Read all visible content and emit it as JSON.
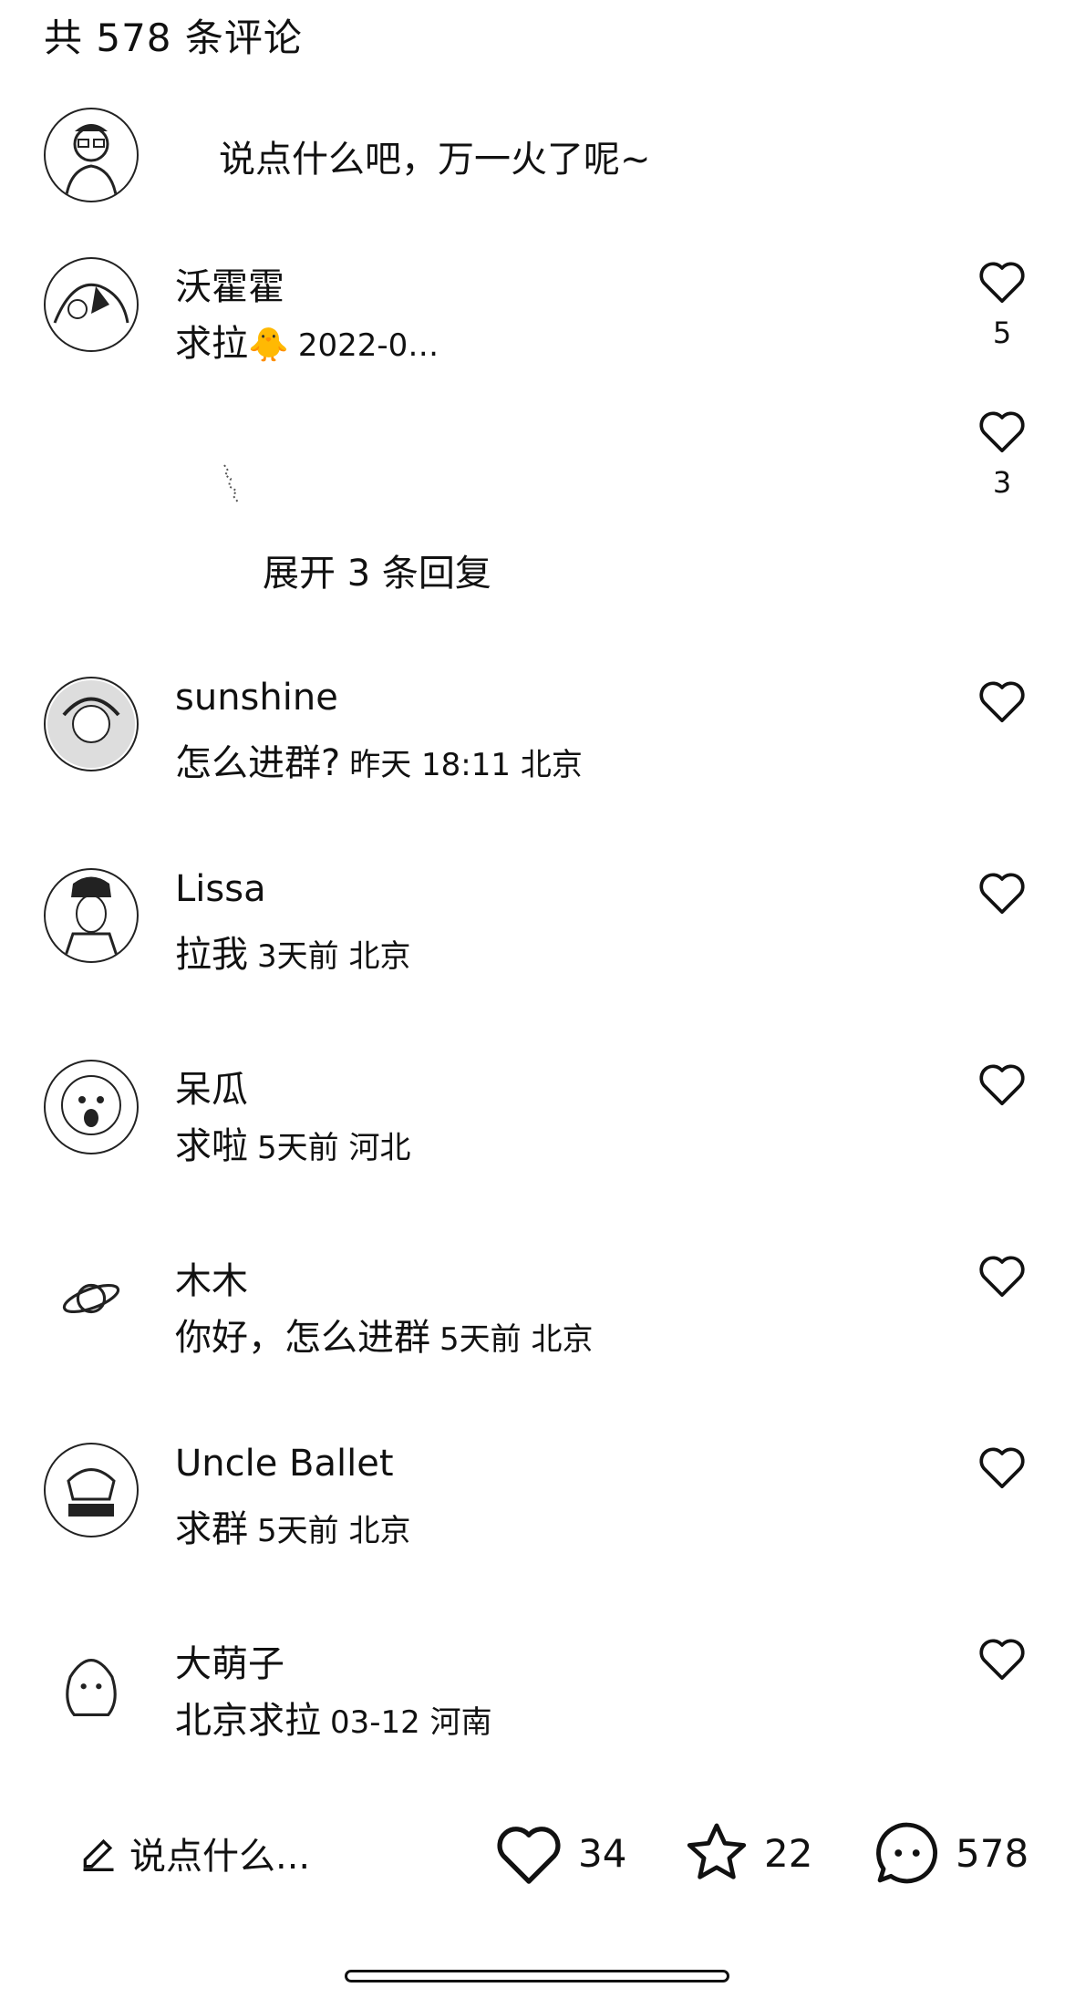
{
  "header": {
    "count_label": "共 578 条评论"
  },
  "compose": {
    "placeholder": "说点什么吧，万一火了呢~"
  },
  "comments": [
    {
      "name": "沃霍霍",
      "text": "求拉",
      "meta": "2022-0…",
      "likes": "5"
    },
    {
      "name": "sunshine",
      "text": "怎么进群?",
      "meta": "昨天 18:11 北京",
      "likes": ""
    },
    {
      "name": "Lissa",
      "text": "拉我",
      "meta": "3天前 北京",
      "likes": ""
    },
    {
      "name": "呆瓜",
      "text": "求啦",
      "meta": "5天前 河北",
      "likes": ""
    },
    {
      "name": "木木",
      "text": "你好，怎么进群",
      "meta": "5天前 北京",
      "likes": ""
    },
    {
      "name": "Uncle Ballet",
      "text": "求群",
      "meta": "5天前 北京",
      "likes": ""
    },
    {
      "name": "大萌子",
      "text": "北京求拉",
      "meta": "03-12 河南",
      "likes": ""
    }
  ],
  "reply": {
    "likes": "3",
    "expand_label": "展开 3 条回复"
  },
  "bottom_bar": {
    "write_label": "说点什么...",
    "like_count": "34",
    "star_count": "22",
    "comment_count": "578"
  },
  "icons": {
    "like": "heart-outline-icon",
    "star": "star-outline-icon",
    "comment": "chat-bubble-icon",
    "write": "pencil-icon",
    "planet": "planet-icon"
  }
}
